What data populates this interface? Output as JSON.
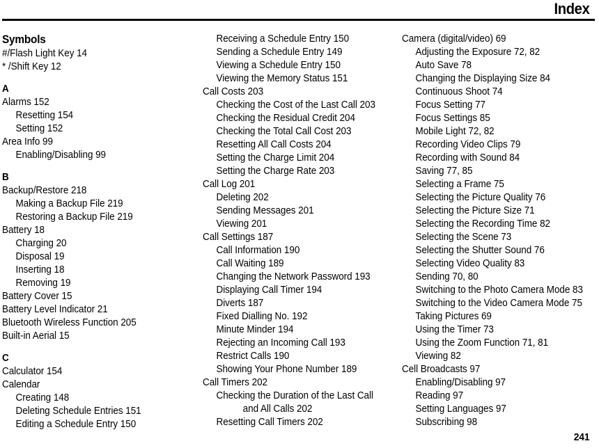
{
  "header": {
    "title": "Index"
  },
  "footer": {
    "page_number": "241"
  },
  "columns": [
    {
      "id": "column-1",
      "blocks": [
        {
          "kind": "section-word",
          "label": "Symbols"
        },
        {
          "kind": "entry",
          "level": 0,
          "label": "#/Flash Light Key 14"
        },
        {
          "kind": "entry",
          "level": 0,
          "label": "* /Shift Key 12"
        },
        {
          "kind": "section-letter",
          "label": "A",
          "spaced": true
        },
        {
          "kind": "entry",
          "level": 0,
          "label": "Alarms 152"
        },
        {
          "kind": "entry",
          "level": 1,
          "label": "Resetting 154"
        },
        {
          "kind": "entry",
          "level": 1,
          "label": "Setting 152"
        },
        {
          "kind": "entry",
          "level": 0,
          "label": "Area Info 99"
        },
        {
          "kind": "entry",
          "level": 1,
          "label": "Enabling/Disabling 99"
        },
        {
          "kind": "section-letter",
          "label": "B",
          "spaced": true
        },
        {
          "kind": "entry",
          "level": 0,
          "label": "Backup/Restore 218"
        },
        {
          "kind": "entry",
          "level": 1,
          "label": "Making a Backup File 219"
        },
        {
          "kind": "entry",
          "level": 1,
          "label": "Restoring a Backup File 219"
        },
        {
          "kind": "entry",
          "level": 0,
          "label": "Battery 18"
        },
        {
          "kind": "entry",
          "level": 1,
          "label": "Charging 20"
        },
        {
          "kind": "entry",
          "level": 1,
          "label": "Disposal 19"
        },
        {
          "kind": "entry",
          "level": 1,
          "label": "Inserting 18"
        },
        {
          "kind": "entry",
          "level": 1,
          "label": "Removing 19"
        },
        {
          "kind": "entry",
          "level": 0,
          "label": "Battery Cover 15"
        },
        {
          "kind": "entry",
          "level": 0,
          "label": "Battery Level Indicator 21"
        },
        {
          "kind": "entry",
          "level": 0,
          "label": "Bluetooth Wireless Function 205"
        },
        {
          "kind": "entry",
          "level": 0,
          "label": "Built-in Aerial 15"
        },
        {
          "kind": "section-letter",
          "label": "C",
          "spaced": true
        },
        {
          "kind": "entry",
          "level": 0,
          "label": "Calculator 154"
        },
        {
          "kind": "entry",
          "level": 0,
          "label": "Calendar"
        },
        {
          "kind": "entry",
          "level": 1,
          "label": "Creating 148"
        },
        {
          "kind": "entry",
          "level": 1,
          "label": "Deleting Schedule Entries 151"
        },
        {
          "kind": "entry",
          "level": 1,
          "label": "Editing a Schedule Entry 150"
        }
      ]
    },
    {
      "id": "column-2",
      "blocks": [
        {
          "kind": "entry",
          "level": 1,
          "label": "Receiving a Schedule Entry 150"
        },
        {
          "kind": "entry",
          "level": 1,
          "label": "Sending a Schedule Entry 149"
        },
        {
          "kind": "entry",
          "level": 1,
          "label": "Viewing a Schedule Entry 150"
        },
        {
          "kind": "entry",
          "level": 1,
          "label": "Viewing the Memory Status 151"
        },
        {
          "kind": "entry",
          "level": 0,
          "label": "Call Costs 203"
        },
        {
          "kind": "entry",
          "level": 1,
          "label": "Checking the Cost of the Last Call 203"
        },
        {
          "kind": "entry",
          "level": 1,
          "label": "Checking the Residual Credit 204"
        },
        {
          "kind": "entry",
          "level": 1,
          "label": "Checking the Total Call Cost 203"
        },
        {
          "kind": "entry",
          "level": 1,
          "label": "Resetting All Call Costs 204"
        },
        {
          "kind": "entry",
          "level": 1,
          "label": "Setting the Charge Limit 204"
        },
        {
          "kind": "entry",
          "level": 1,
          "label": "Setting the Charge Rate 203"
        },
        {
          "kind": "entry",
          "level": 0,
          "label": "Call Log 201"
        },
        {
          "kind": "entry",
          "level": 1,
          "label": "Deleting 202"
        },
        {
          "kind": "entry",
          "level": 1,
          "label": "Sending Messages 201"
        },
        {
          "kind": "entry",
          "level": 1,
          "label": "Viewing 201"
        },
        {
          "kind": "entry",
          "level": 0,
          "label": "Call Settings 187"
        },
        {
          "kind": "entry",
          "level": 1,
          "label": "Call Information 190"
        },
        {
          "kind": "entry",
          "level": 1,
          "label": "Call Waiting 189"
        },
        {
          "kind": "entry",
          "level": 1,
          "label": "Changing the Network Password 193"
        },
        {
          "kind": "entry",
          "level": 1,
          "label": "Displaying Call Timer 194"
        },
        {
          "kind": "entry",
          "level": 1,
          "label": "Diverts 187"
        },
        {
          "kind": "entry",
          "level": 1,
          "label": "Fixed Dialling No. 192"
        },
        {
          "kind": "entry",
          "level": 1,
          "label": "Minute Minder 194"
        },
        {
          "kind": "entry",
          "level": 1,
          "label": "Rejecting an Incoming Call 193"
        },
        {
          "kind": "entry",
          "level": 1,
          "label": "Restrict Calls 190"
        },
        {
          "kind": "entry",
          "level": 1,
          "label": "Showing Your Phone Number 189"
        },
        {
          "kind": "entry",
          "level": 0,
          "label": "Call Timers 202"
        },
        {
          "kind": "entry",
          "level": 1,
          "label": "Checking the Duration of the Last Call"
        },
        {
          "kind": "entry",
          "level": 2,
          "label": "and All Calls 202"
        },
        {
          "kind": "entry",
          "level": 1,
          "label": "Resetting Call Timers 202"
        }
      ]
    },
    {
      "id": "column-3",
      "blocks": [
        {
          "kind": "entry",
          "level": 0,
          "label": "Camera (digital/video) 69"
        },
        {
          "kind": "entry",
          "level": 1,
          "label": "Adjusting the Exposure 72, 82"
        },
        {
          "kind": "entry",
          "level": 1,
          "label": "Auto Save 78"
        },
        {
          "kind": "entry",
          "level": 1,
          "label": "Changing the Displaying Size 84"
        },
        {
          "kind": "entry",
          "level": 1,
          "label": "Continuous Shoot 74"
        },
        {
          "kind": "entry",
          "level": 1,
          "label": "Focus Setting 77"
        },
        {
          "kind": "entry",
          "level": 1,
          "label": "Focus Settings 85"
        },
        {
          "kind": "entry",
          "level": 1,
          "label": "Mobile Light 72, 82"
        },
        {
          "kind": "entry",
          "level": 1,
          "label": "Recording Video Clips 79"
        },
        {
          "kind": "entry",
          "level": 1,
          "label": "Recording with Sound 84"
        },
        {
          "kind": "entry",
          "level": 1,
          "label": "Saving 77, 85"
        },
        {
          "kind": "entry",
          "level": 1,
          "label": "Selecting a Frame 75"
        },
        {
          "kind": "entry",
          "level": 1,
          "label": "Selecting the Picture Quality 76"
        },
        {
          "kind": "entry",
          "level": 1,
          "label": "Selecting the Picture Size 71"
        },
        {
          "kind": "entry",
          "level": 1,
          "label": "Selecting the Recording Time 82"
        },
        {
          "kind": "entry",
          "level": 1,
          "label": "Selecting the Scene 73"
        },
        {
          "kind": "entry",
          "level": 1,
          "label": "Selecting the Shutter Sound 76"
        },
        {
          "kind": "entry",
          "level": 1,
          "label": "Selecting Video Quality 83"
        },
        {
          "kind": "entry",
          "level": 1,
          "label": "Sending 70, 80"
        },
        {
          "kind": "entry",
          "level": 1,
          "label": "Switching to the Photo Camera Mode 83"
        },
        {
          "kind": "entry",
          "level": 1,
          "label": "Switching to the Video Camera Mode 75"
        },
        {
          "kind": "entry",
          "level": 1,
          "label": "Taking Pictures 69"
        },
        {
          "kind": "entry",
          "level": 1,
          "label": "Using the Timer 73"
        },
        {
          "kind": "entry",
          "level": 1,
          "label": "Using the Zoom Function 71, 81"
        },
        {
          "kind": "entry",
          "level": 1,
          "label": "Viewing 82"
        },
        {
          "kind": "entry",
          "level": 0,
          "label": "Cell Broadcasts 97"
        },
        {
          "kind": "entry",
          "level": 1,
          "label": "Enabling/Disabling 97"
        },
        {
          "kind": "entry",
          "level": 1,
          "label": "Reading 97"
        },
        {
          "kind": "entry",
          "level": 1,
          "label": "Setting Languages 97"
        },
        {
          "kind": "entry",
          "level": 1,
          "label": "Subscribing 98"
        }
      ]
    }
  ]
}
